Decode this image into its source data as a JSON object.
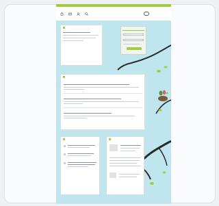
{
  "topbar": {
    "links": ""
  },
  "header": {
    "nav_icons": [
      "home-icon",
      "mail-icon",
      "user-icon",
      "search-icon"
    ],
    "logo_text": ""
  },
  "intro_panel": {
    "title": ""
  },
  "login": {
    "title": ""
  },
  "blog_panel": {
    "title": ""
  },
  "left_panel": {
    "title": ""
  },
  "right_panel": {
    "title": ""
  },
  "footer": {
    "text": ""
  },
  "colors": {
    "accent": "#9fcf3f",
    "background": "#bfe6ee",
    "branch": "#2b2b2b"
  }
}
